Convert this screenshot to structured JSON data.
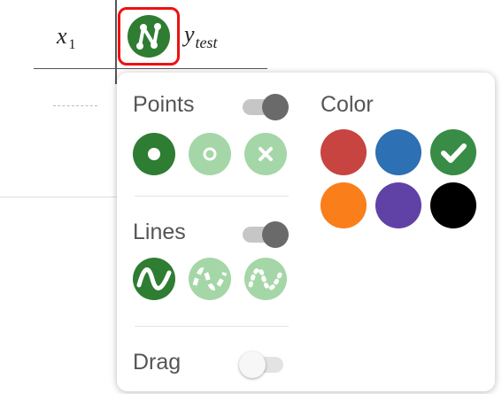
{
  "table": {
    "col1_var": "x",
    "col1_sub": "1",
    "col2_var": "y",
    "col2_sub": "test"
  },
  "panel": {
    "points": {
      "label": "Points",
      "toggle_on": true,
      "styles": [
        "point-dot-icon",
        "point-open-circle-icon",
        "point-cross-icon"
      ],
      "selected": "point-dot-icon"
    },
    "lines": {
      "label": "Lines",
      "toggle_on": true,
      "styles": [
        "line-solid-icon",
        "line-dashed-icon",
        "line-dotted-icon"
      ],
      "selected": "line-solid-icon"
    },
    "drag": {
      "label": "Drag",
      "toggle_on": false
    },
    "color": {
      "label": "Color",
      "options": [
        {
          "name": "red",
          "hex": "#c74440"
        },
        {
          "name": "blue",
          "hex": "#2d70b3"
        },
        {
          "name": "green",
          "hex": "#388c46"
        },
        {
          "name": "orange",
          "hex": "#fa7e19"
        },
        {
          "name": "purple",
          "hex": "#6042a6"
        },
        {
          "name": "black",
          "hex": "#000000"
        }
      ],
      "selected": "green"
    }
  }
}
